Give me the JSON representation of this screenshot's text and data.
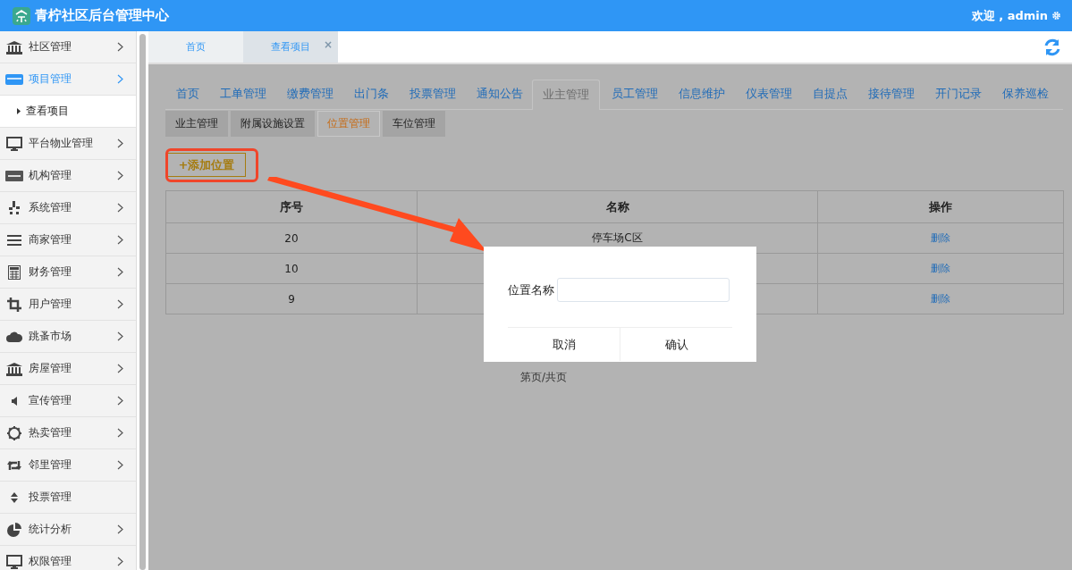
{
  "header": {
    "title": "青柠社区后台管理中心",
    "welcome": "欢迎 , admin"
  },
  "sidebar": {
    "items": [
      {
        "label": "社区管理",
        "expanded": false,
        "expandable": true
      },
      {
        "label": "项目管理",
        "expanded": true,
        "expandable": true,
        "children": [
          {
            "label": "查看项目"
          }
        ]
      },
      {
        "label": "平台物业管理",
        "expanded": false,
        "expandable": true
      },
      {
        "label": "机构管理",
        "expanded": false,
        "expandable": true
      },
      {
        "label": "系统管理",
        "expanded": false,
        "expandable": true
      },
      {
        "label": "商家管理",
        "expanded": false,
        "expandable": true
      },
      {
        "label": "财务管理",
        "expanded": false,
        "expandable": true
      },
      {
        "label": "用户管理",
        "expanded": false,
        "expandable": true
      },
      {
        "label": "跳蚤市场",
        "expanded": false,
        "expandable": true
      },
      {
        "label": "房屋管理",
        "expanded": false,
        "expandable": true
      },
      {
        "label": "宣传管理",
        "expanded": false,
        "expandable": true
      },
      {
        "label": "热卖管理",
        "expanded": false,
        "expandable": true
      },
      {
        "label": "邻里管理",
        "expanded": false,
        "expandable": true
      },
      {
        "label": "投票管理",
        "expanded": false,
        "expandable": false
      },
      {
        "label": "统计分析",
        "expanded": false,
        "expandable": true
      },
      {
        "label": "权限管理",
        "expanded": false,
        "expandable": true
      }
    ]
  },
  "tabs": [
    {
      "label": "首页",
      "selected": false
    },
    {
      "label": "查看项目",
      "selected": true,
      "close": "×"
    }
  ],
  "nav_tabs": [
    {
      "label": "首页",
      "selected": false
    },
    {
      "label": "工单管理",
      "selected": false
    },
    {
      "label": "缴费管理",
      "selected": false
    },
    {
      "label": "出门条",
      "selected": false
    },
    {
      "label": "投票管理",
      "selected": false
    },
    {
      "label": "通知公告",
      "selected": false
    },
    {
      "label": "业主管理",
      "selected": true
    },
    {
      "label": "员工管理",
      "selected": false
    },
    {
      "label": "信息维护",
      "selected": false
    },
    {
      "label": "仪表管理",
      "selected": false
    },
    {
      "label": "自提点",
      "selected": false
    },
    {
      "label": "接待管理",
      "selected": false
    },
    {
      "label": "开门记录",
      "selected": false
    },
    {
      "label": "保养巡检",
      "selected": false
    }
  ],
  "sub_tabs": [
    {
      "label": "业主管理",
      "selected": false
    },
    {
      "label": "附属设施设置",
      "selected": false
    },
    {
      "label": "位置管理",
      "selected": true
    },
    {
      "label": "车位管理",
      "selected": false
    }
  ],
  "add_button": "+添加位置",
  "table": {
    "columns": [
      "序号",
      "名称",
      "操作"
    ],
    "rows": [
      {
        "cells": [
          "20",
          "停车场C区"
        ],
        "action": "删除"
      },
      {
        "cells": [
          "10"
        ],
        "action": "删除"
      },
      {
        "cells": [
          "9"
        ],
        "action": "删除"
      }
    ]
  },
  "pager": "第页/共页",
  "dialog": {
    "field_label": "位置名称",
    "buttons": [
      "取消",
      "确认"
    ]
  }
}
